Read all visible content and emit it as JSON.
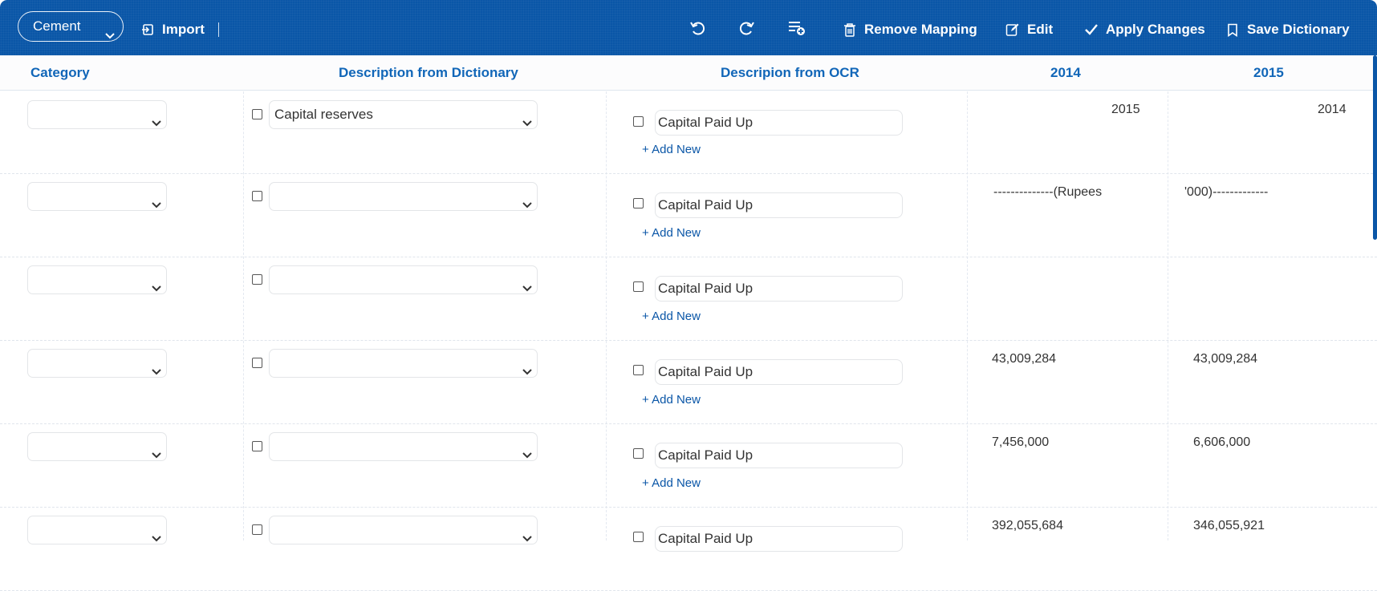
{
  "toolbar": {
    "template_select": "Cement",
    "import_label": "Import",
    "remove_mapping_label": "Remove Mapping",
    "edit_label": "Edit",
    "apply_changes_label": "Apply Changes",
    "save_dictionary_label": "Save Dictionary"
  },
  "columns": {
    "category": "Category",
    "dictionary": "Description from Dictionary",
    "ocr": "Descripion from OCR",
    "y2014": "2014",
    "y2015": "2015"
  },
  "add_new_label": "+ Add New",
  "rows": [
    {
      "category": "",
      "dictionary": "Capital reserves",
      "ocr": "Capital Paid Up",
      "v2014": "2015",
      "v2015": "2014"
    },
    {
      "category": "",
      "dictionary": "",
      "ocr": "Capital Paid Up",
      "v2014": "--------------(Rupees",
      "v2015": "'000)-------------"
    },
    {
      "category": "",
      "dictionary": "",
      "ocr": "Capital Paid Up",
      "v2014": "",
      "v2015": ""
    },
    {
      "category": "",
      "dictionary": "",
      "ocr": "Capital Paid Up",
      "v2014": "43,009,284",
      "v2015": "43,009,284"
    },
    {
      "category": "",
      "dictionary": "",
      "ocr": "Capital Paid Up",
      "v2014": "7,456,000",
      "v2015": "6,606,000"
    },
    {
      "category": "",
      "dictionary": "",
      "ocr": "Capital Paid Up",
      "v2014": "392,055,684",
      "v2015": "346,055,921"
    }
  ],
  "colors": {
    "accent": "#0a56a7",
    "header_text": "#1166b8"
  }
}
